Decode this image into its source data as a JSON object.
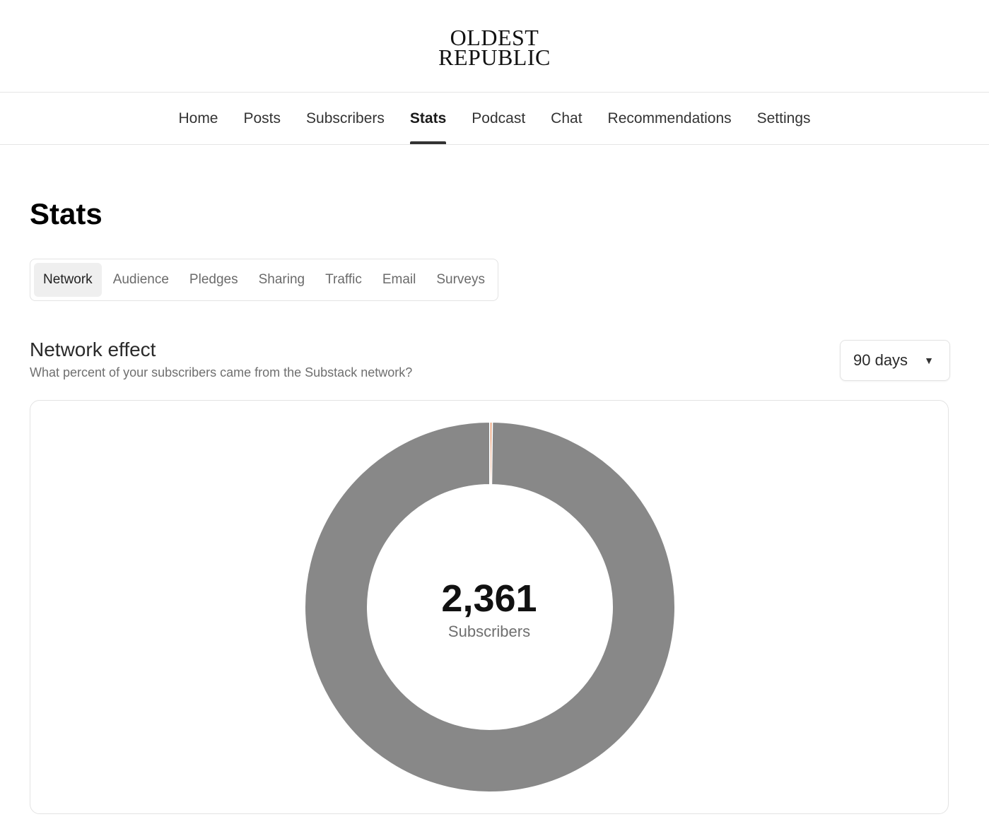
{
  "logo": {
    "line1": "OLDEST",
    "line2": "REPUBLIC"
  },
  "nav": {
    "items": [
      {
        "label": "Home"
      },
      {
        "label": "Posts"
      },
      {
        "label": "Subscribers"
      },
      {
        "label": "Stats",
        "active": true
      },
      {
        "label": "Podcast"
      },
      {
        "label": "Chat"
      },
      {
        "label": "Recommendations"
      },
      {
        "label": "Settings"
      }
    ]
  },
  "page": {
    "title": "Stats"
  },
  "subtabs": {
    "items": [
      {
        "label": "Network",
        "active": true
      },
      {
        "label": "Audience"
      },
      {
        "label": "Pledges"
      },
      {
        "label": "Sharing"
      },
      {
        "label": "Traffic"
      },
      {
        "label": "Email"
      },
      {
        "label": "Surveys"
      }
    ]
  },
  "section": {
    "title": "Network effect",
    "subtitle": "What percent of your subscribers came from the Substack network?"
  },
  "range": {
    "value": "90 days",
    "icon": "caret-down-icon"
  },
  "donut": {
    "center_value": "2,361",
    "center_label": "Subscribers"
  },
  "colors": {
    "main_segment": "#888888",
    "network_segment": "#e07034",
    "active_underline": "#333333"
  },
  "chart_data": {
    "type": "pie",
    "style": "donut",
    "slices": [
      {
        "value": 0.2,
        "color": "#e07034"
      },
      {
        "value": 99.8,
        "color": "#888888"
      }
    ],
    "center_text": "2,361",
    "center_subtext": "Subscribers"
  }
}
